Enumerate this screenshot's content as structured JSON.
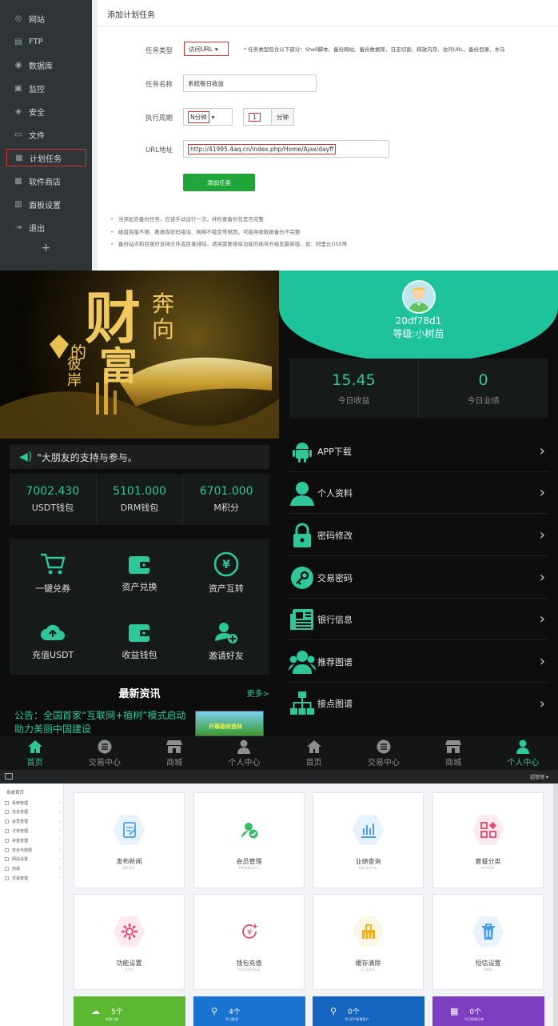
{
  "panel": {
    "sidebar": [
      {
        "label": "网站",
        "icon": "globe-icon"
      },
      {
        "label": "FTP",
        "icon": "ftp-icon"
      },
      {
        "label": "数据库",
        "icon": "database-icon"
      },
      {
        "label": "监控",
        "icon": "monitor-icon"
      },
      {
        "label": "安全",
        "icon": "shield-icon"
      },
      {
        "label": "文件",
        "icon": "folder-icon"
      },
      {
        "label": "计划任务",
        "icon": "calendar-icon",
        "active": true
      },
      {
        "label": "软件商店",
        "icon": "apps-icon"
      },
      {
        "label": "面板设置",
        "icon": "settings-icon"
      },
      {
        "label": "退出",
        "icon": "logout-icon"
      }
    ],
    "add_symbol": "+",
    "title": "添加计划任务",
    "form": {
      "task_type_label": "任务类型",
      "task_type_value": "访问URL",
      "task_type_note": "任务类型包含以下部分：Shell脚本、备份网站、备份数据库、日志切割、释放内存、访问URL、备份目录、木马",
      "task_name_label": "任务名称",
      "task_name_value": "系统每日收益",
      "cycle_label": "执行周期",
      "cycle_value": "N分钟",
      "cycle_number": "1",
      "cycle_unit": "分钟",
      "url_label": "URL地址",
      "url_value": "http://41995.4aq.cn/index.php/Home/Ajax/dayff",
      "submit_label": "添加任务"
    },
    "tips": [
      "当添加完备份任务，应该手动运行一次，并检查备份包是否完整",
      "磁盘容量不够、数据库密码错误、网络不稳定等原因，可能导致数据备份不完整",
      "备份站点和目录时支持文件或目录排除，请将需要排除功能的插件升级到最新版，如：阿里云OSS等"
    ]
  },
  "app_left": {
    "marquee": "\"大朋友的支持与参与。",
    "wallets": [
      {
        "value": "7002.430",
        "label": "USDT钱包"
      },
      {
        "value": "5101.000",
        "label": "DRM钱包"
      },
      {
        "value": "6701.000",
        "label": "M积分"
      }
    ],
    "actions": [
      {
        "label": "一键兑券",
        "icon": "cart-icon"
      },
      {
        "label": "资产兑换",
        "icon": "wallet-icon"
      },
      {
        "label": "资产互转",
        "icon": "exchange-icon"
      },
      {
        "label": "充值USDT",
        "icon": "cloud-upload-icon"
      },
      {
        "label": "收益钱包",
        "icon": "purse-icon"
      },
      {
        "label": "邀请好友",
        "icon": "add-user-icon"
      }
    ],
    "news_title": "最新资讯",
    "news_more": "更多>",
    "news_text": "公告：全国首家“互联网+植树”模式启动助力美丽中国建设",
    "news_image_text": "开幕植树造林",
    "hero_text": {
      "big1": "财",
      "big2": "富",
      "small1": "奔",
      "small2": "向",
      "side1": "的",
      "side2": "彼岸"
    }
  },
  "app_right": {
    "uid": "20df78d1",
    "level": "等级:小树苗",
    "stats": [
      {
        "value": "15.45",
        "label": "今日收益"
      },
      {
        "value": "0",
        "label": "今日业绩"
      }
    ],
    "menu": [
      {
        "label": "APP下载",
        "icon": "android-icon"
      },
      {
        "label": "个人资料",
        "icon": "user-icon"
      },
      {
        "label": "密码修改",
        "icon": "lock-icon"
      },
      {
        "label": "交易密码",
        "icon": "key-icon"
      },
      {
        "label": "银行信息",
        "icon": "newspaper-icon"
      },
      {
        "label": "推荐图谱",
        "icon": "users-icon"
      },
      {
        "label": "接点图谱",
        "icon": "sitemap-icon"
      }
    ],
    "chevron": "›"
  },
  "tabs": [
    {
      "label": "首页",
      "icon": "home-icon"
    },
    {
      "label": "交易中心",
      "icon": "list-icon"
    },
    {
      "label": "商城",
      "icon": "store-icon"
    },
    {
      "label": "个人中心",
      "icon": "person-icon"
    }
  ],
  "admin": {
    "user": "超管理 ▾",
    "sidebar_head": "系统首页",
    "sidebar": [
      "系统管理",
      "信息管理",
      "会员管理",
      "订单管理",
      "资金管理",
      "安全与权限",
      "网站设置",
      "商城",
      "交易管理"
    ],
    "cards": [
      {
        "title": "发布新闻",
        "sub": "NEWS",
        "icon": "edit-icon",
        "color": "#4a9ee8",
        "bg": "#e7f2fd"
      },
      {
        "title": "会员管理",
        "sub": "PRODUCT",
        "icon": "member-icon",
        "color": "#3cbb67",
        "bg": "#ffffff"
      },
      {
        "title": "业绩查询",
        "sub": "RELEASE",
        "icon": "chart-icon",
        "color": "#4a9ee8",
        "bg": "#e7f2fd"
      },
      {
        "title": "套餐分类",
        "sub": "SPARE",
        "icon": "category-icon",
        "color": "#e8466b",
        "bg": "#fde9ee"
      },
      {
        "title": "功能设置",
        "sub": "APP",
        "icon": "gear-icon",
        "color": "#e8466b",
        "bg": "#fde9ee"
      },
      {
        "title": "钱包充值",
        "sub": "RECHARGE",
        "icon": "yen-icon",
        "color": "#e8466b",
        "bg": "#ffffff"
      },
      {
        "title": "缓存清除",
        "sub": "CLEAR",
        "icon": "broom-icon",
        "color": "#f0b020",
        "bg": "#fef6e4"
      },
      {
        "title": "短信设置",
        "sub": "SMS",
        "icon": "trash-icon",
        "color": "#4a9ee8",
        "bg": "#e7f2fd"
      }
    ],
    "summary": [
      {
        "value": "5个",
        "label": "新增人数",
        "color": "#5cb832"
      },
      {
        "value": "4个",
        "label": "今日登录",
        "color": "#1a73d1"
      },
      {
        "value": "0个",
        "label": "今日0个新增用户",
        "color": "#1565c0"
      },
      {
        "value": "0个",
        "label": "今日新增订单",
        "color": "#7d3ec2"
      }
    ]
  }
}
